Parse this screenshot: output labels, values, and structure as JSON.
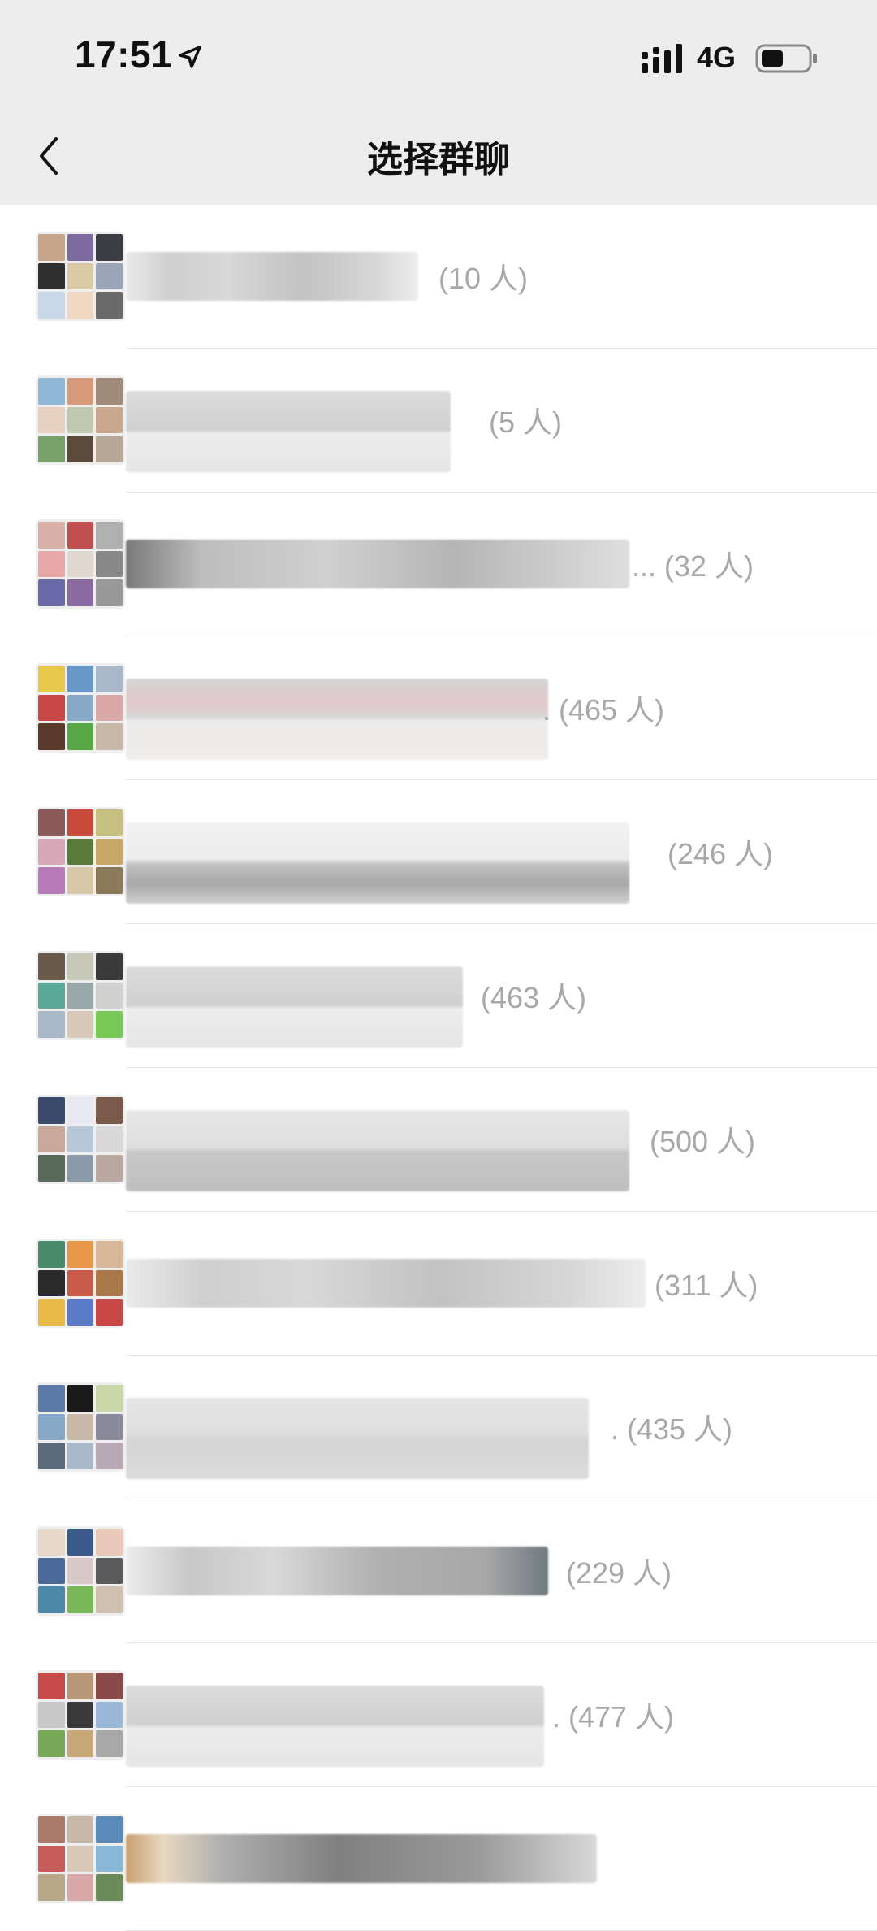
{
  "status_bar": {
    "time": "17:51",
    "network": "4G"
  },
  "nav": {
    "title": "选择群聊"
  },
  "groups": [
    {
      "count": "(10 人)"
    },
    {
      "count": "(5 人)"
    },
    {
      "count": "... (32 人)"
    },
    {
      "count": ". (465 人)"
    },
    {
      "count": "(246 人)"
    },
    {
      "count": "(463 人)"
    },
    {
      "count": "(500 人)"
    },
    {
      "count": "(311 人)"
    },
    {
      "count": ". (435 人)"
    },
    {
      "count": "(229 人)"
    },
    {
      "count": ". (477 人)"
    },
    {
      "count": ""
    }
  ]
}
